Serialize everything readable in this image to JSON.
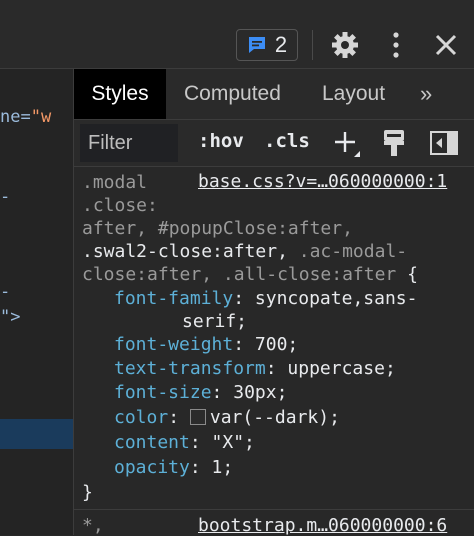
{
  "toolbar": {
    "issues_count": "2",
    "icons": [
      "issues-icon",
      "gear-icon",
      "kebab-menu-icon",
      "close-icon"
    ]
  },
  "elements_panel": {
    "line1_attr": "ne=",
    "line1_value": "\"w",
    "line2": "-",
    "line3": "-",
    "line4": "\">"
  },
  "tabs": {
    "styles": "Styles",
    "computed": "Computed",
    "layout": "Layout",
    "more": "»"
  },
  "filter": {
    "placeholder": "Filter",
    "hov": ":hov",
    "cls": ".cls"
  },
  "rule1": {
    "source": "base.css?v=…060000000:1",
    "sel_line1": ".modal",
    "sel_line2": ".close:",
    "sel_line3": "after, #popupClose:after,",
    "sel_line4_bright": ".swal2-close:after,",
    "sel_line4_dim": " .ac-modal-",
    "sel_line5_dim": "close:after, .all-close:after",
    "open_brace": " {",
    "close_brace": "}",
    "declarations": [
      {
        "prop": "font-family",
        "value": "syncopate,sans-"
      },
      {
        "prop": "",
        "value": "serif;"
      },
      {
        "prop": "font-weight",
        "value": "700;"
      },
      {
        "prop": "text-transform",
        "value": "uppercase;"
      },
      {
        "prop": "font-size",
        "value": "30px;"
      },
      {
        "prop": "color",
        "value": "var(--dark);"
      },
      {
        "prop": "content",
        "value": "\"X\";"
      },
      {
        "prop": "opacity",
        "value": "1;"
      }
    ]
  },
  "rule2": {
    "selector": "*,",
    "source": "bootstrap.m…060000000:6"
  },
  "colors": {
    "background": "#282828",
    "property": "#5db0d7",
    "selected_row": "#1a3b5c",
    "issues_icon": "#3c8df5"
  }
}
